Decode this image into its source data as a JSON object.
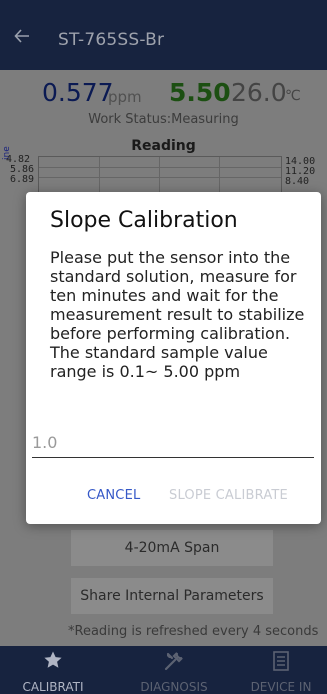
{
  "appbar": {
    "title": "ST-765SS-Br"
  },
  "readings": {
    "ppm_value": "0.577",
    "ppm_unit": "ppm",
    "ph_value": "5.50",
    "temp_value": "26.0",
    "temp_unit": "℃",
    "work_status": "Work Status:Measuring"
  },
  "chart": {
    "title": "Reading",
    "left_ticks": [
      "4.82",
      "5.86",
      "6.89"
    ],
    "right_ticks": [
      "14.00",
      "11.20",
      "8.40"
    ],
    "left_axis_fragment": "ine"
  },
  "buttons": {
    "span": "4-20mA Span",
    "share": "Share Internal Parameters"
  },
  "refresh_note": "*Reading is refreshed every 4 seconds",
  "bottomnav": {
    "calibration": "CALIBRATI",
    "diagnosis": "DIAGNOSIS",
    "device_info": "DEVICE IN"
  },
  "dialog": {
    "title": "Slope Calibration",
    "message": "Please put the sensor into the standard solution, measure for ten minutes and wait for the measurement result to stabilize before performing calibration. The standard sample value range is 0.1~ 5.00 ppm",
    "input_placeholder": "1.0",
    "cancel_label": "CANCEL",
    "confirm_label": "SLOPE CALIBRATE"
  },
  "colors": {
    "appbar_bg": "#17233f",
    "scrim": "#7d7d7d",
    "accent": "#3558c7",
    "disabled": "#c9ccd3",
    "ppm_color": "#0b1a53",
    "ph_color": "#1c4f12"
  },
  "icons": {
    "back": "arrow-left-icon",
    "calibration": "star-icon",
    "diagnosis": "tools-icon",
    "device_info": "document-icon"
  }
}
